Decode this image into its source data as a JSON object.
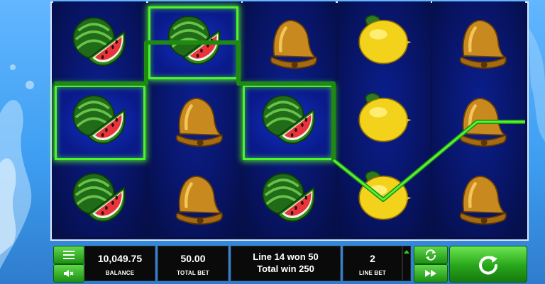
{
  "grid": {
    "reels": [
      [
        "watermelon",
        "watermelon",
        "watermelon"
      ],
      [
        "watermelon",
        "bell",
        "bell"
      ],
      [
        "bell",
        "watermelon",
        "watermelon"
      ],
      [
        "lemon",
        "lemon",
        "lemon"
      ],
      [
        "bell",
        "bell",
        "bell"
      ]
    ],
    "winning_cells": [
      [
        0,
        1
      ],
      [
        1,
        0
      ],
      [
        2,
        1
      ]
    ],
    "win_color": "#4cf42a"
  },
  "controls": {
    "menu_icon": "menu-icon",
    "sound_icon": "sound-mute-icon",
    "balance_value": "10,049.75",
    "balance_label": "BALANCE",
    "total_bet_value": "50.00",
    "total_bet_label": "TOTAL BET",
    "win_message_line1": "Line 14 won 50",
    "win_message_line2": "Total win 250",
    "line_bet_value": "2",
    "line_bet_label": "LINE BET",
    "autoplay_icon": "autoplay-icon",
    "turbo_icon": "fast-forward-icon",
    "spin_icon": "spin-icon"
  }
}
